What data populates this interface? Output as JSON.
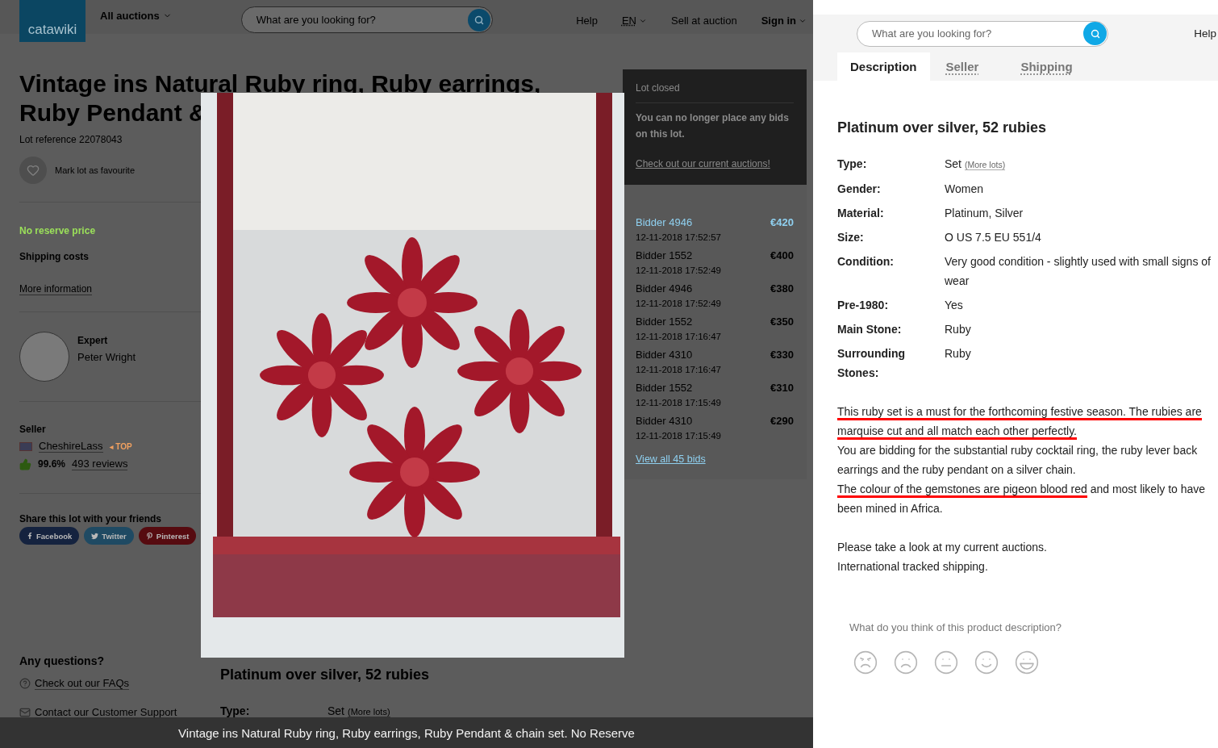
{
  "left_page": {
    "header": {
      "logo": "catawiki",
      "menu": "All auctions",
      "search": {
        "placeholder": "What are you looking for?"
      },
      "nav": [
        {
          "label": "Help",
          "kind": "link"
        },
        {
          "label": "EN",
          "kind": "language"
        },
        {
          "label": "Sell at auction",
          "kind": "link"
        },
        {
          "label": "Sign in",
          "kind": "account"
        }
      ]
    },
    "title": "Vintage ins Natural Ruby ring, Ruby earrings, Ruby Pendant &",
    "lot_reference": "Lot reference 22078043",
    "favourite": "Mark lot as favourite",
    "reserve": "No reserve price",
    "shipping": {
      "title": "Shipping costs",
      "link": "More information"
    },
    "expert": {
      "role": "Expert",
      "name": "Peter Wright"
    },
    "seller": {
      "title": "Seller",
      "name": "CheshireLass",
      "badge": "◂ TOP",
      "score": "99.6%",
      "reviews": "493 reviews"
    },
    "share": {
      "title": "Share this lot with your friends",
      "buttons": [
        {
          "label": "Facebook",
          "kind": "facebook"
        },
        {
          "label": "Twitter",
          "kind": "twitter"
        },
        {
          "label": "Pinterest",
          "kind": "pinterest"
        }
      ]
    },
    "questions": {
      "title": "Any questions?",
      "links": [
        {
          "label": "Check out our FAQs",
          "kind": "faq"
        },
        {
          "label": "Contact our Customer Support",
          "kind": "contact"
        }
      ]
    },
    "status": {
      "title": "Lot closed",
      "message": "You can no longer place any bids on this lot.",
      "link": "Check out our current auctions!"
    },
    "bids": [
      {
        "bidder": "Bidder 4946",
        "time": "12-11-2018 17:52:57",
        "amount": "€420",
        "leading": true
      },
      {
        "bidder": "Bidder 1552",
        "time": "12-11-2018 17:52:49",
        "amount": "€400",
        "leading": false
      },
      {
        "bidder": "Bidder 4946",
        "time": "12-11-2018 17:52:49",
        "amount": "€380",
        "leading": false
      },
      {
        "bidder": "Bidder 1552",
        "time": "12-11-2018 17:16:47",
        "amount": "€350",
        "leading": false
      },
      {
        "bidder": "Bidder 4310",
        "time": "12-11-2018 17:16:47",
        "amount": "€330",
        "leading": false
      },
      {
        "bidder": "Bidder 1552",
        "time": "12-11-2018 17:15:49",
        "amount": "€310",
        "leading": false
      },
      {
        "bidder": "Bidder 4310",
        "time": "12-11-2018 17:15:49",
        "amount": "€290",
        "leading": false
      }
    ],
    "view_all": "View all 45 bids",
    "description": {
      "title": "Platinum over silver, 52 rubies",
      "rows": [
        {
          "label": "Type:",
          "value": "Set",
          "link": "(More lots)"
        }
      ]
    },
    "photo_caption": "Vintage ins Natural Ruby ring, Ruby earrings, Ruby Pendant & chain set. No Reserve"
  },
  "right_panel": {
    "search": {
      "placeholder": "What are you looking for?"
    },
    "help": "Help",
    "tabs": [
      {
        "label": "Description",
        "selected": true
      },
      {
        "label": "Seller",
        "selected": false
      },
      {
        "label": "Shipping",
        "selected": false
      }
    ],
    "title": "Platinum over silver, 52 rubies",
    "specs": [
      {
        "label": "Type:",
        "value": "Set",
        "link": "(More lots)"
      },
      {
        "label": "Gender:",
        "value": "Women"
      },
      {
        "label": "Material:",
        "value": "Platinum, Silver"
      },
      {
        "label": "Size:",
        "value": "O US 7.5 EU 551/4"
      },
      {
        "label": "Condition:",
        "value": "Very good condition - slightly used with small signs of wear"
      },
      {
        "label": "Pre-1980:",
        "value": "Yes"
      },
      {
        "label": "Main Stone:",
        "value": "Ruby"
      },
      {
        "label": "Surrounding Stones:",
        "value": "Ruby"
      }
    ],
    "description": [
      [
        [
          {
            "text": "This ruby set is a must for the forthcoming festive season. The rubies are marquise cut and all match each other perfectly.",
            "underlined": true
          }
        ],
        [
          {
            "text": "You are bidding for the substantial ruby cocktail ring, the ruby lever back earrings and the ruby pendant on a silver chain.",
            "underlined": false
          }
        ],
        [
          {
            "text": "The colour of the gemstones are pigeon blood red",
            "underlined": true
          },
          {
            "text": " and most likely to have been mined in Africa.",
            "underlined": false
          }
        ]
      ],
      [
        [
          {
            "text": "Please take a look at my current auctions.",
            "underlined": false
          }
        ],
        [
          {
            "text": "International tracked shipping.",
            "underlined": false
          }
        ]
      ]
    ],
    "feedback": "What do you think of this product description?"
  }
}
